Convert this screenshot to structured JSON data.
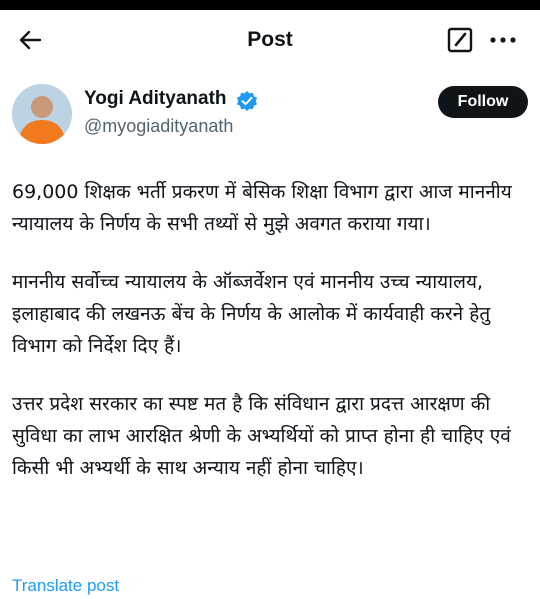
{
  "header": {
    "title": "Post",
    "back_icon": "arrow-left-icon",
    "edit_icon": "edit-square-icon",
    "more_icon": "more-horizontal-icon"
  },
  "author": {
    "name": "Yogi Adityanath",
    "handle": "@myogiadityanath",
    "verified_icon": "verified-badge-icon",
    "verified_color": "#1d9bf0",
    "follow_label": "Follow"
  },
  "post": {
    "paragraphs": [
      "69,000 शिक्षक भर्ती प्रकरण में बेसिक शिक्षा विभाग द्वारा आज माननीय न्यायालय के निर्णय के सभी तथ्यों से मुझे अवगत कराया गया।",
      "माननीय सर्वोच्च न्यायालय के ऑब्जर्वेशन एवं माननीय उच्च न्यायालय, इलाहाबाद की लखनऊ बेंच के निर्णय के आलोक में कार्यवाही करने हेतु विभाग को निर्देश दिए हैं।",
      "उत्तर प्रदेश सरकार का स्पष्ट मत है कि संविधान द्वारा प्रदत्त आरक्षण की सुविधा का लाभ आरक्षित श्रेणी के अभ्यर्थियों को प्राप्त होना ही चाहिए एवं किसी भी अभ्यर्थी के साथ अन्याय नहीं होना चाहिए।"
    ],
    "translate_label": "Translate post"
  },
  "colors": {
    "text": "#0f1419",
    "secondary": "#536471",
    "link": "#1d9bf0"
  }
}
